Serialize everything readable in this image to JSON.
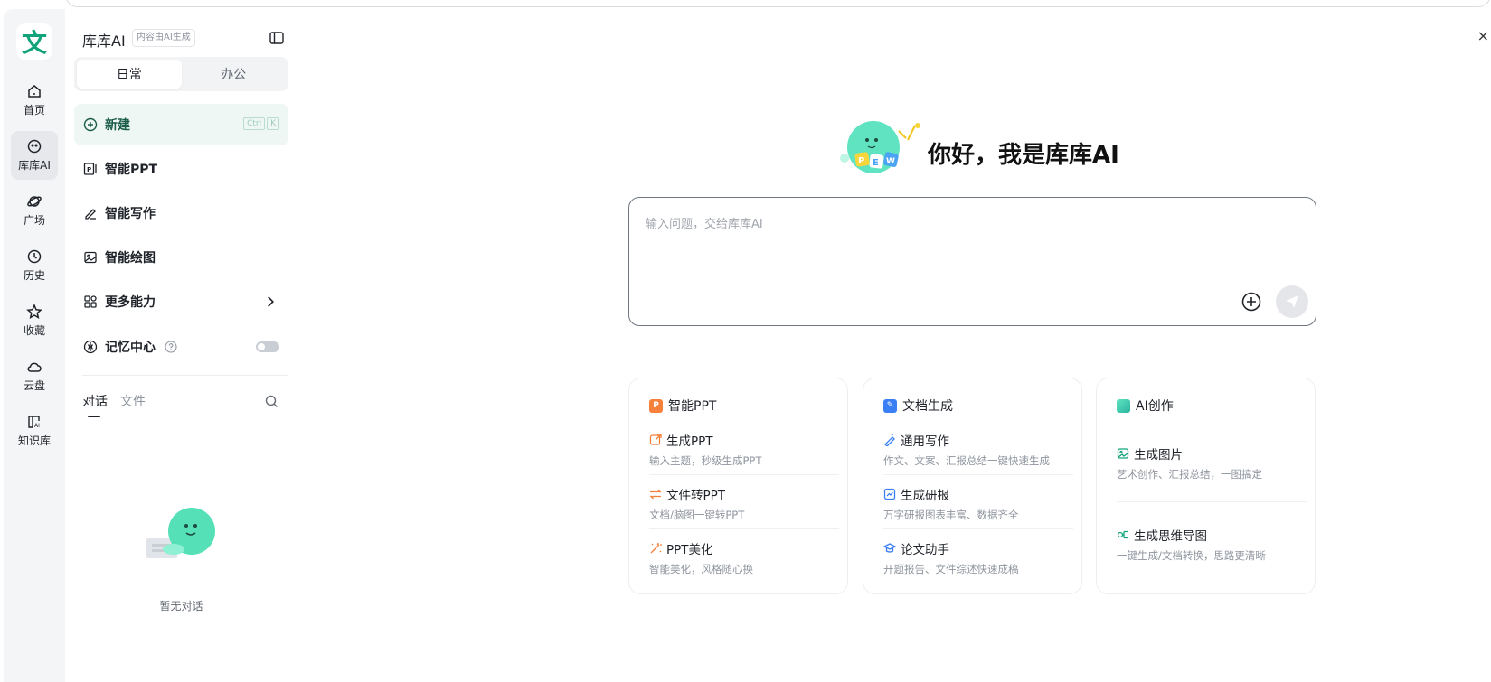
{
  "rail": {
    "logo": "文",
    "items": [
      {
        "label": "首页",
        "icon": "home-icon"
      },
      {
        "label": "库库AI",
        "icon": "bot-icon"
      },
      {
        "label": "广场",
        "icon": "planet-icon"
      },
      {
        "label": "历史",
        "icon": "clock-icon"
      },
      {
        "label": "收藏",
        "icon": "star-icon"
      },
      {
        "label": "云盘",
        "icon": "cloud-icon"
      },
      {
        "label": "知识库",
        "icon": "knowledge-icon"
      }
    ]
  },
  "panel": {
    "title": "库库AI",
    "tag": "内容由AI生成",
    "segments": [
      "日常",
      "办公"
    ],
    "nav": {
      "new": "新建",
      "shortcut": [
        "Ctrl",
        "K"
      ],
      "ppt": "智能PPT",
      "writing": "智能写作",
      "drawing": "智能绘图",
      "more": "更多能力",
      "memory": "记忆中心"
    },
    "tabs": [
      "对话",
      "文件"
    ],
    "empty": "暂无对话"
  },
  "main": {
    "greeting": "你好，我是库库AI",
    "mascot_letters": [
      "P",
      "E",
      "W"
    ],
    "input_placeholder": "输入问题，交给库库AI",
    "cards": [
      {
        "title": "智能PPT",
        "items": [
          {
            "title": "生成PPT",
            "sub": "输入主题，秒级生成PPT"
          },
          {
            "title": "文件转PPT",
            "sub": "文档/脑图一键转PPT"
          },
          {
            "title": "PPT美化",
            "sub": "智能美化，风格随心换"
          }
        ]
      },
      {
        "title": "文档生成",
        "items": [
          {
            "title": "通用写作",
            "sub": "作文、文案、汇报总结一键快速生成"
          },
          {
            "title": "生成研报",
            "sub": "万字研报图表丰富、数据齐全"
          },
          {
            "title": "论文助手",
            "sub": "开题报告、文件综述快速成稿"
          }
        ]
      },
      {
        "title": "AI创作",
        "items": [
          {
            "title": "生成图片",
            "sub": "艺术创作、汇报总结，一图搞定"
          },
          {
            "title": "生成思维导图",
            "sub": "一键生成/文档转换，思路更清晰"
          }
        ]
      }
    ]
  },
  "colors": {
    "brand": "#12a37a",
    "accent_orange": "#f5813a",
    "accent_blue": "#3b7ff5"
  }
}
